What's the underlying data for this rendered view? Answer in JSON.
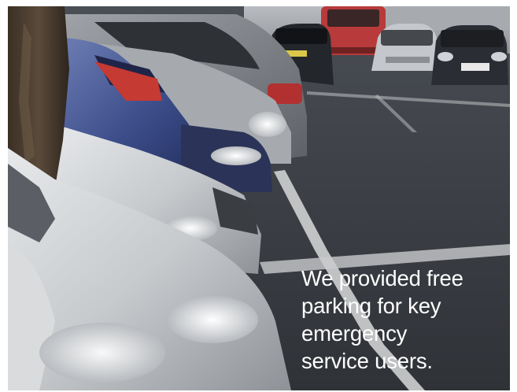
{
  "photo": {
    "caption_lines": [
      "We provided free",
      "parking for key",
      "emergency",
      "service users."
    ]
  }
}
